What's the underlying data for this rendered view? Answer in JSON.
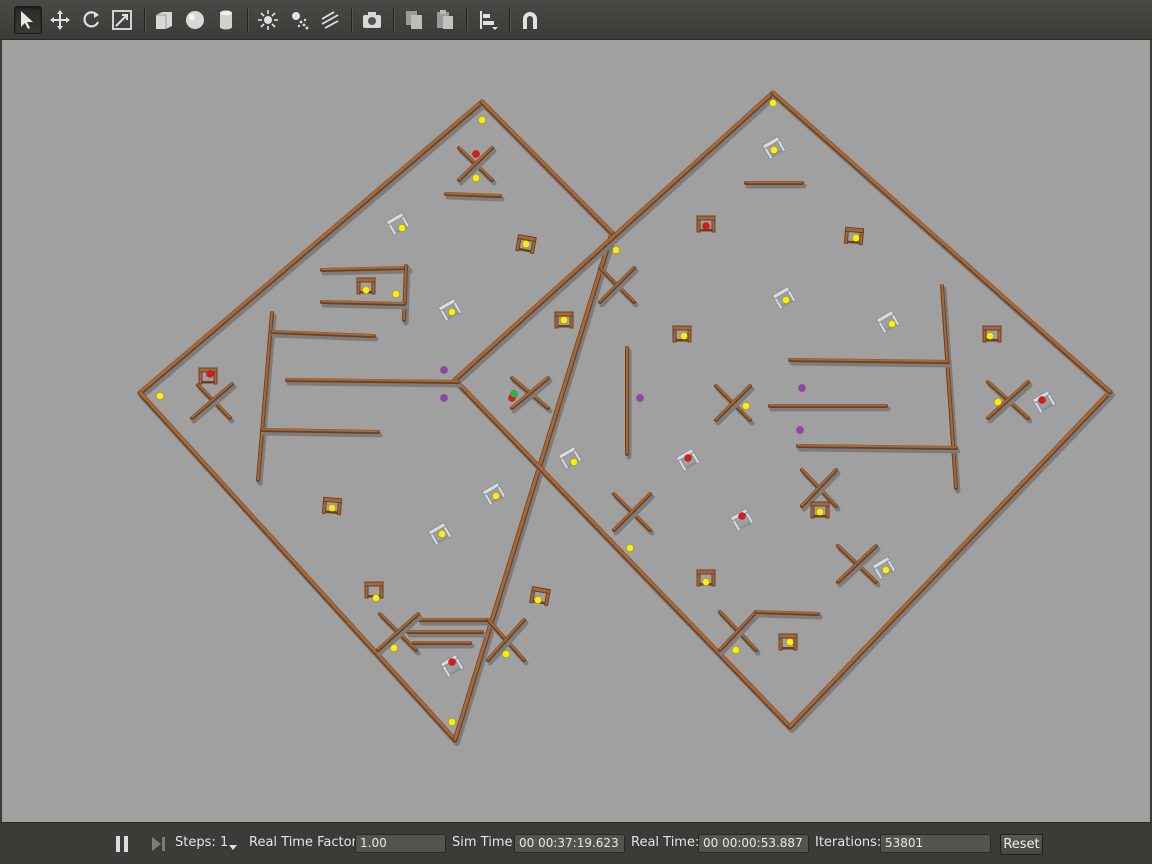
{
  "toolbar": {
    "tools": [
      {
        "name": "select-mode-icon",
        "active": true
      },
      {
        "name": "translate-mode-icon",
        "active": false
      },
      {
        "name": "rotate-mode-icon",
        "active": false
      },
      {
        "name": "scale-mode-icon",
        "active": false
      },
      {
        "name": "box-shape-icon",
        "active": false
      },
      {
        "name": "sphere-shape-icon",
        "active": false
      },
      {
        "name": "cylinder-shape-icon",
        "active": false
      },
      {
        "name": "point-light-icon",
        "active": false
      },
      {
        "name": "spot-light-icon",
        "active": false
      },
      {
        "name": "directional-light-icon",
        "active": false
      },
      {
        "name": "screenshot-camera-icon",
        "active": false
      },
      {
        "name": "copy-icon",
        "active": false
      },
      {
        "name": "paste-icon",
        "active": false
      },
      {
        "name": "align-icon",
        "active": false
      },
      {
        "name": "snap-magnet-icon",
        "active": false
      }
    ]
  },
  "status": {
    "steps_label": "Steps:",
    "steps_value": "1",
    "rtf_label": "Real Time Factor:",
    "rtf_value": "1.00",
    "sim_time_label": "Sim Time:",
    "sim_time_value": "00 00:37:19.623",
    "real_time_label": "Real Time:",
    "real_time_value": "00 00:00:53.887",
    "iterations_label": "Iterations:",
    "iterations_value": "53801",
    "reset_label": "Reset"
  },
  "colors": {
    "viewport_bg": "#a0a0a0",
    "wall": "#a3693a",
    "wall_dark": "#6e4020",
    "marker_yellow": "#ffee00",
    "marker_red": "#e01818",
    "marker_purple": "#9b3fb0",
    "marker_green": "#2dbb3a",
    "chair_metal": "#d8dce0"
  }
}
